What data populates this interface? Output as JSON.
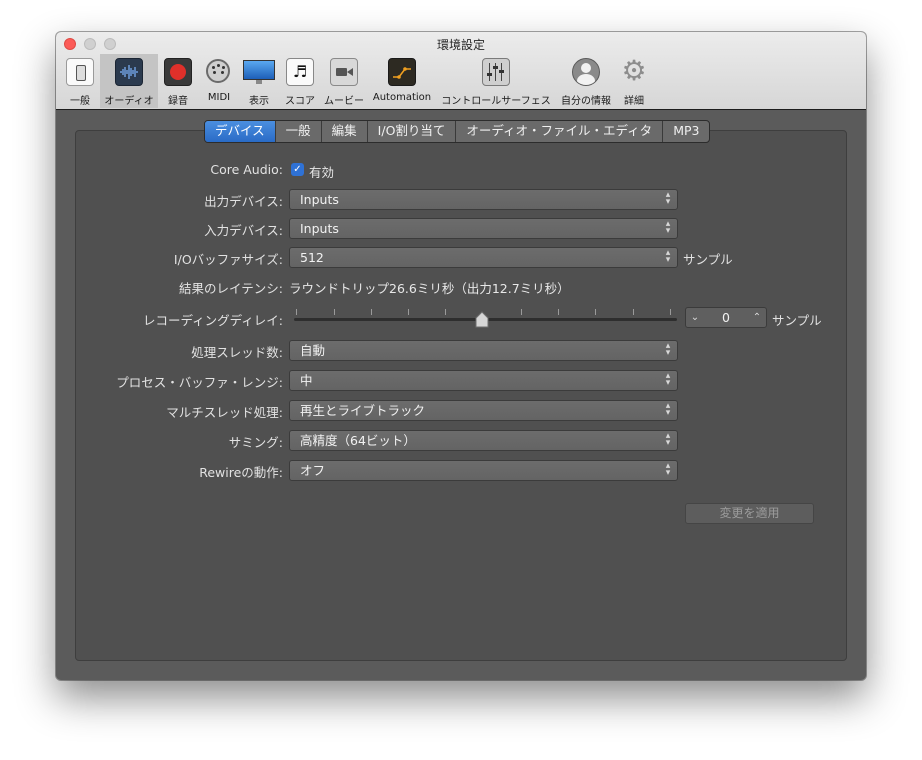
{
  "window": {
    "title": "環境設定"
  },
  "toolbar": {
    "items": [
      {
        "label": "一般",
        "icon": "switch-icon"
      },
      {
        "label": "オーディオ",
        "icon": "waveform-icon",
        "active": true
      },
      {
        "label": "録音",
        "icon": "record-icon"
      },
      {
        "label": "MIDI",
        "icon": "midi-port-icon"
      },
      {
        "label": "表示",
        "icon": "display-icon"
      },
      {
        "label": "スコア",
        "icon": "score-icon"
      },
      {
        "label": "ムービー",
        "icon": "movie-camera-icon"
      },
      {
        "label": "Automation",
        "icon": "automation-icon"
      },
      {
        "label": "コントロールサーフェス",
        "icon": "faders-icon"
      },
      {
        "label": "自分の情報",
        "icon": "user-icon"
      },
      {
        "label": "詳細",
        "icon": "gear-icon"
      }
    ]
  },
  "tabs": [
    {
      "label": "デバイス",
      "active": true
    },
    {
      "label": "一般"
    },
    {
      "label": "編集"
    },
    {
      "label": "I/O割り当て"
    },
    {
      "label": "オーディオ・ファイル・エディタ"
    },
    {
      "label": "MP3"
    }
  ],
  "form": {
    "core_audio_label": "Core Audio:",
    "core_audio_value": "有効",
    "output_label": "出力デバイス:",
    "output_value": "Inputs",
    "input_label": "入力デバイス:",
    "input_value": "Inputs",
    "buffer_label": "I/Oバッファサイズ:",
    "buffer_value": "512",
    "buffer_unit": "サンプル",
    "latency_label": "結果のレイテンシ:",
    "latency_value": "ラウンドトリップ26.6ミリ秒（出力12.7ミリ秒）",
    "rec_delay_label": "レコーディングディレイ:",
    "rec_delay_value": "0",
    "rec_delay_unit": "サンプル",
    "threads_label": "処理スレッド数:",
    "threads_value": "自動",
    "range_label": "プロセス・バッファ・レンジ:",
    "range_value": "中",
    "multithread_label": "マルチスレッド処理:",
    "multithread_value": "再生とライブトラック",
    "summing_label": "サミング:",
    "summing_value": "高精度（64ビット）",
    "rewire_label": "Rewireの動作:",
    "rewire_value": "オフ",
    "apply_label": "変更を適用"
  },
  "colors": {
    "accent": "#2f72d6",
    "panel": "#505050",
    "record": "#e0302a"
  }
}
